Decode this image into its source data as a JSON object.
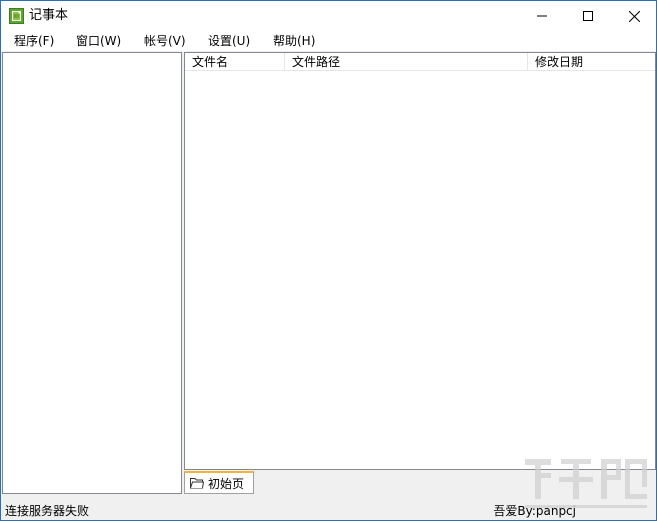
{
  "window": {
    "title": "记事本",
    "controls": {
      "minimize": "minimize",
      "maximize": "maximize",
      "close": "close"
    }
  },
  "menu": {
    "items": [
      {
        "label": "程序(F)"
      },
      {
        "label": "窗口(W)"
      },
      {
        "label": "帐号(V)"
      },
      {
        "label": "设置(U)"
      },
      {
        "label": "帮助(H)"
      }
    ]
  },
  "file_list": {
    "columns": [
      {
        "label": "文件名"
      },
      {
        "label": "文件路径"
      },
      {
        "label": "修改日期"
      }
    ],
    "rows": []
  },
  "tabs": [
    {
      "label": "初始页",
      "icon": "folder-icon",
      "active": true
    }
  ],
  "status": {
    "left": "连接服务器失败",
    "right": "吾爱By:panpcj"
  },
  "colors": {
    "accent_tab": "#f4b43a",
    "window_border": "#2b6fb5",
    "app_icon_green": "#5aa832"
  }
}
